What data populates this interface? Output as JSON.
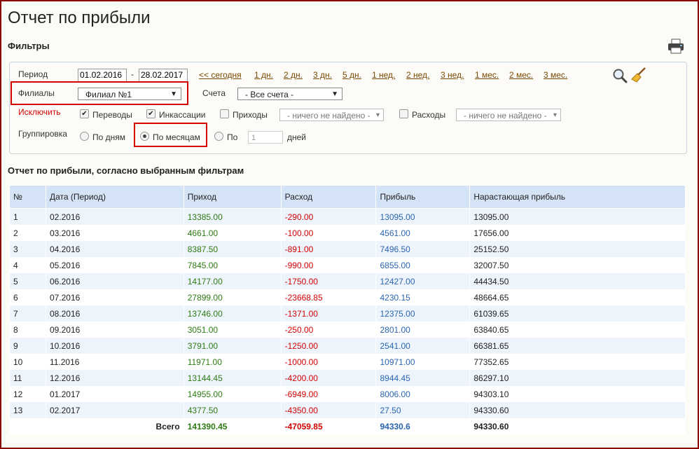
{
  "title": "Отчет по прибыли",
  "filters": {
    "heading": "Фильтры",
    "period_label": "Период",
    "date_from": "01.02.2016",
    "date_sep": "-",
    "date_to": "28.02.2017",
    "quick_periods": [
      "<< сегодня",
      "1 дн.",
      "2 дн.",
      "3 дн.",
      "5 дн.",
      "1 нед.",
      "2 нед.",
      "3 нед.",
      "1 мес.",
      "2 мес.",
      "3 мес."
    ],
    "branches_label": "Филиалы",
    "branch_value": "Филиал №1",
    "accounts_label": "Счета",
    "accounts_value": "- Все счета -",
    "exclude_label": "Исключить",
    "transfers_label": "Переводы",
    "collections_label": "Инкассации",
    "incomes_label": "Приходы",
    "incomes_value": "- ничего не найдено -",
    "expenses_label": "Расходы",
    "expenses_value": "- ничего не найдено -",
    "grouping_label": "Группировка",
    "by_days": "По дням",
    "by_months": "По месяцам",
    "by_n": "По",
    "n_value": "1",
    "days": "дней"
  },
  "report": {
    "heading": "Отчет по прибыли, согласно выбранным фильтрам",
    "columns": [
      "№",
      "Дата (Период)",
      "Приход",
      "Расход",
      "Прибыль",
      "Нарастающая прибыль"
    ],
    "rows": [
      [
        "1",
        "02.2016",
        "13385.00",
        "-290.00",
        "13095.00",
        "13095.00"
      ],
      [
        "2",
        "03.2016",
        "4661.00",
        "-100.00",
        "4561.00",
        "17656.00"
      ],
      [
        "3",
        "04.2016",
        "8387.50",
        "-891.00",
        "7496.50",
        "25152.50"
      ],
      [
        "4",
        "05.2016",
        "7845.00",
        "-990.00",
        "6855.00",
        "32007.50"
      ],
      [
        "5",
        "06.2016",
        "14177.00",
        "-1750.00",
        "12427.00",
        "44434.50"
      ],
      [
        "6",
        "07.2016",
        "27899.00",
        "-23668.85",
        "4230.15",
        "48664.65"
      ],
      [
        "7",
        "08.2016",
        "13746.00",
        "-1371.00",
        "12375.00",
        "61039.65"
      ],
      [
        "8",
        "09.2016",
        "3051.00",
        "-250.00",
        "2801.00",
        "63840.65"
      ],
      [
        "9",
        "10.2016",
        "3791.00",
        "-1250.00",
        "2541.00",
        "66381.65"
      ],
      [
        "10",
        "11.2016",
        "11971.00",
        "-1000.00",
        "10971.00",
        "77352.65"
      ],
      [
        "11",
        "12.2016",
        "13144.45",
        "-4200.00",
        "8944.45",
        "86297.10"
      ],
      [
        "12",
        "01.2017",
        "14955.00",
        "-6949.00",
        "8006.00",
        "94303.10"
      ],
      [
        "13",
        "02.2017",
        "4377.50",
        "-4350.00",
        "27.50",
        "94330.60"
      ]
    ],
    "total_label": "Всего",
    "total_income": "141390.45",
    "total_expense": "-47059.85",
    "total_profit": "94330.6",
    "total_cumulative": "94330.60"
  },
  "colors": {
    "income": "#2d7a12",
    "expense": "#d40000",
    "profit": "#2a65b0",
    "highlight": "#d40000"
  },
  "icons": [
    "printer-icon",
    "search-icon",
    "broom-icon",
    "chevron-down-icon"
  ]
}
